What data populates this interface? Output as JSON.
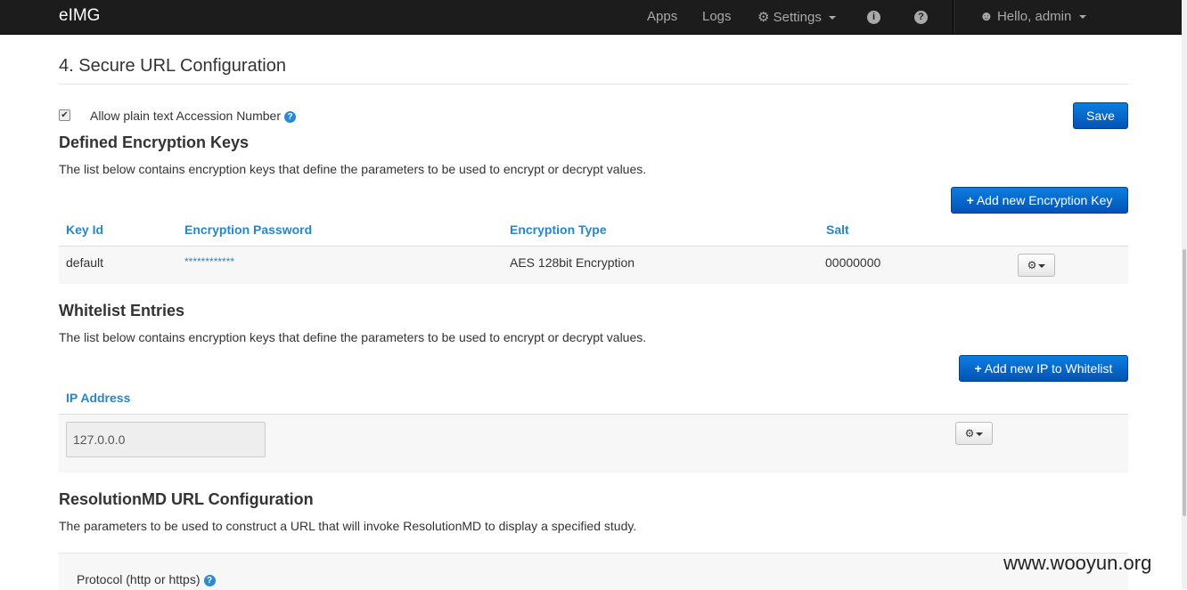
{
  "navbar": {
    "brand": "eIMG",
    "apps": "Apps",
    "logs": "Logs",
    "settings": "Settings",
    "user": "Hello, admin"
  },
  "section": {
    "title": "4. Secure URL Configuration",
    "allow_label": "Allow plain text Accession Number",
    "save_label": "Save"
  },
  "encryption": {
    "heading": "Defined Encryption Keys",
    "description": "The list below contains encryption keys that define the parameters to be used to encrypt or decrypt values.",
    "add_label": "Add new Encryption Key",
    "columns": [
      "Key Id",
      "Encryption Password",
      "Encryption Type",
      "Salt"
    ],
    "rows": [
      {
        "key_id": "default",
        "password": "************",
        "type": "AES 128bit Encryption",
        "salt": "00000000"
      }
    ]
  },
  "whitelist": {
    "heading": "Whitelist Entries",
    "description": "The list below contains encryption keys that define the parameters to be used to encrypt or decrypt values.",
    "add_label": "Add new IP to Whitelist",
    "column": "IP Address",
    "ip_value": "127.0.0.0"
  },
  "resolution": {
    "heading": "ResolutionMD URL Configuration",
    "description": "The parameters to be used to construct a URL that will invoke ResolutionMD to display a specified study.",
    "protocol_label": "Protocol (http or https)"
  },
  "watermark": "www.wooyun.org",
  "icons": {
    "settings": "gears-icon",
    "info": "info-circle-icon",
    "help": "question-circle-icon",
    "user": "user-icon",
    "gear": "gear-icon",
    "plus": "plus-icon"
  },
  "colors": {
    "navbar": "#1c1c1c",
    "primary": "#0b6fd1",
    "link": "#2a86c4"
  }
}
